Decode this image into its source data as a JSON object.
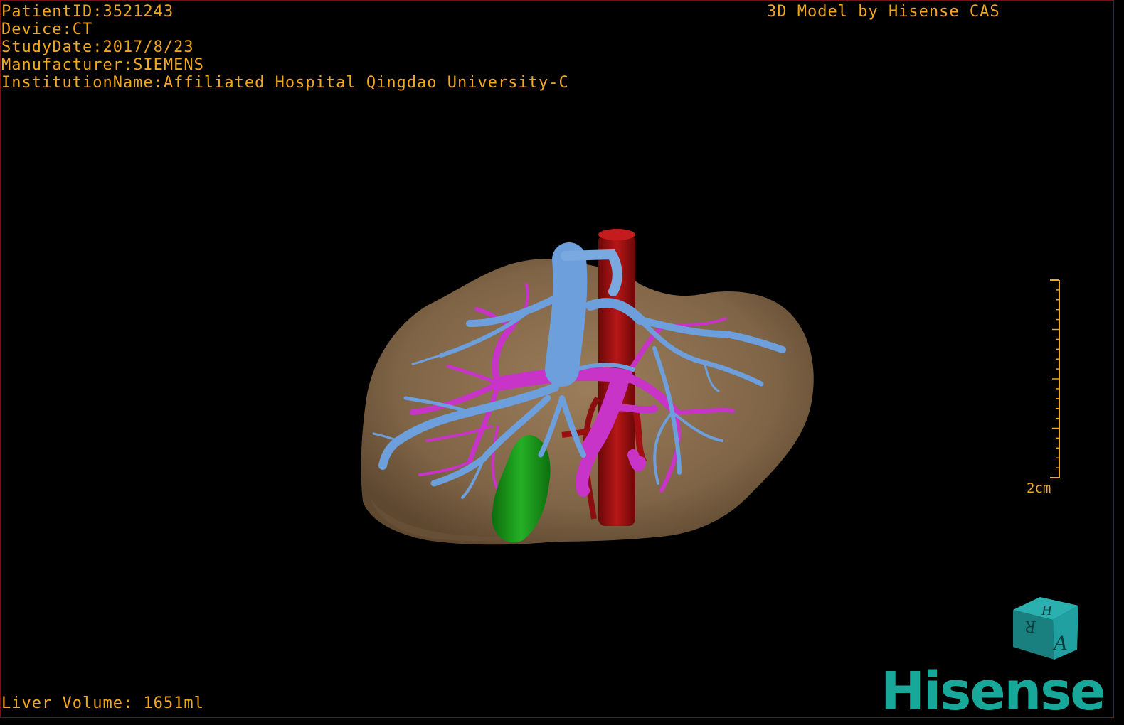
{
  "overlay": {
    "patient_id": "PatientID:3521243",
    "device": "Device:CT",
    "study_date": "StudyDate:2017/8/23",
    "manufacturer": "Manufacturer:SIEMENS",
    "institution": "InstitutionName:Affiliated Hospital Qingdao University-C",
    "credit": "3D Model by Hisense CAS",
    "liver_volume": "Liver Volume: 1651ml"
  },
  "scale_bar": {
    "label": "2cm"
  },
  "orientation_cube": {
    "front_letter": "A",
    "top_letter": "H",
    "side_letter": "R"
  },
  "logo": {
    "text": "Hisense"
  },
  "colors": {
    "overlay_text": "#f2a81c",
    "liver": "#8a6e4e",
    "hepatic_vein": "#6d9fdc",
    "portal_vein": "#c833c8",
    "ivc_artery": "#a51010",
    "gallbladder": "#18a018",
    "logo": "#17a89a",
    "cube": "#1d8c8c"
  },
  "structures": [
    "liver",
    "hepatic-veins",
    "portal-veins",
    "aorta",
    "gallbladder"
  ]
}
